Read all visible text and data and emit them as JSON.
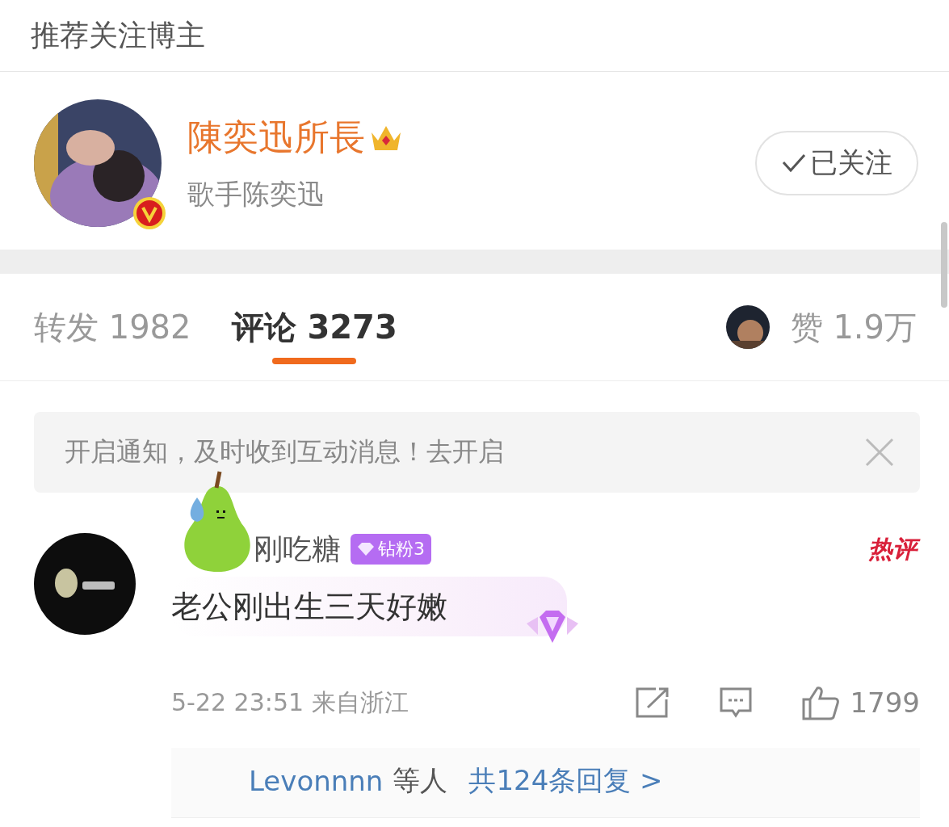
{
  "header": {
    "title": "推荐关注博主"
  },
  "blogger": {
    "name": "陳奕迅所長",
    "bio": "歌手陈奕迅",
    "verified": true,
    "follow_button": {
      "label": "已关注",
      "followed": true
    }
  },
  "tabs": [
    {
      "label": "转发",
      "count": "1982",
      "selected": false
    },
    {
      "label": "评论",
      "count": "3273",
      "selected": true
    }
  ],
  "likes": {
    "label": "赞",
    "count": "1.9万"
  },
  "notice": {
    "text": "开启通知，及时收到互动消息！去开启"
  },
  "comments": [
    {
      "user": "刚吃糖",
      "fan_badge": "钻粉3",
      "hot_badge": "热评",
      "text": "老公刚出生三天好嫩",
      "meta": "5-22 23:51 来自浙江",
      "like_count": "1799",
      "reply_users": "Levonnnn",
      "reply_suffix": "等人",
      "reply_link": "共124条回复 >"
    }
  ]
}
